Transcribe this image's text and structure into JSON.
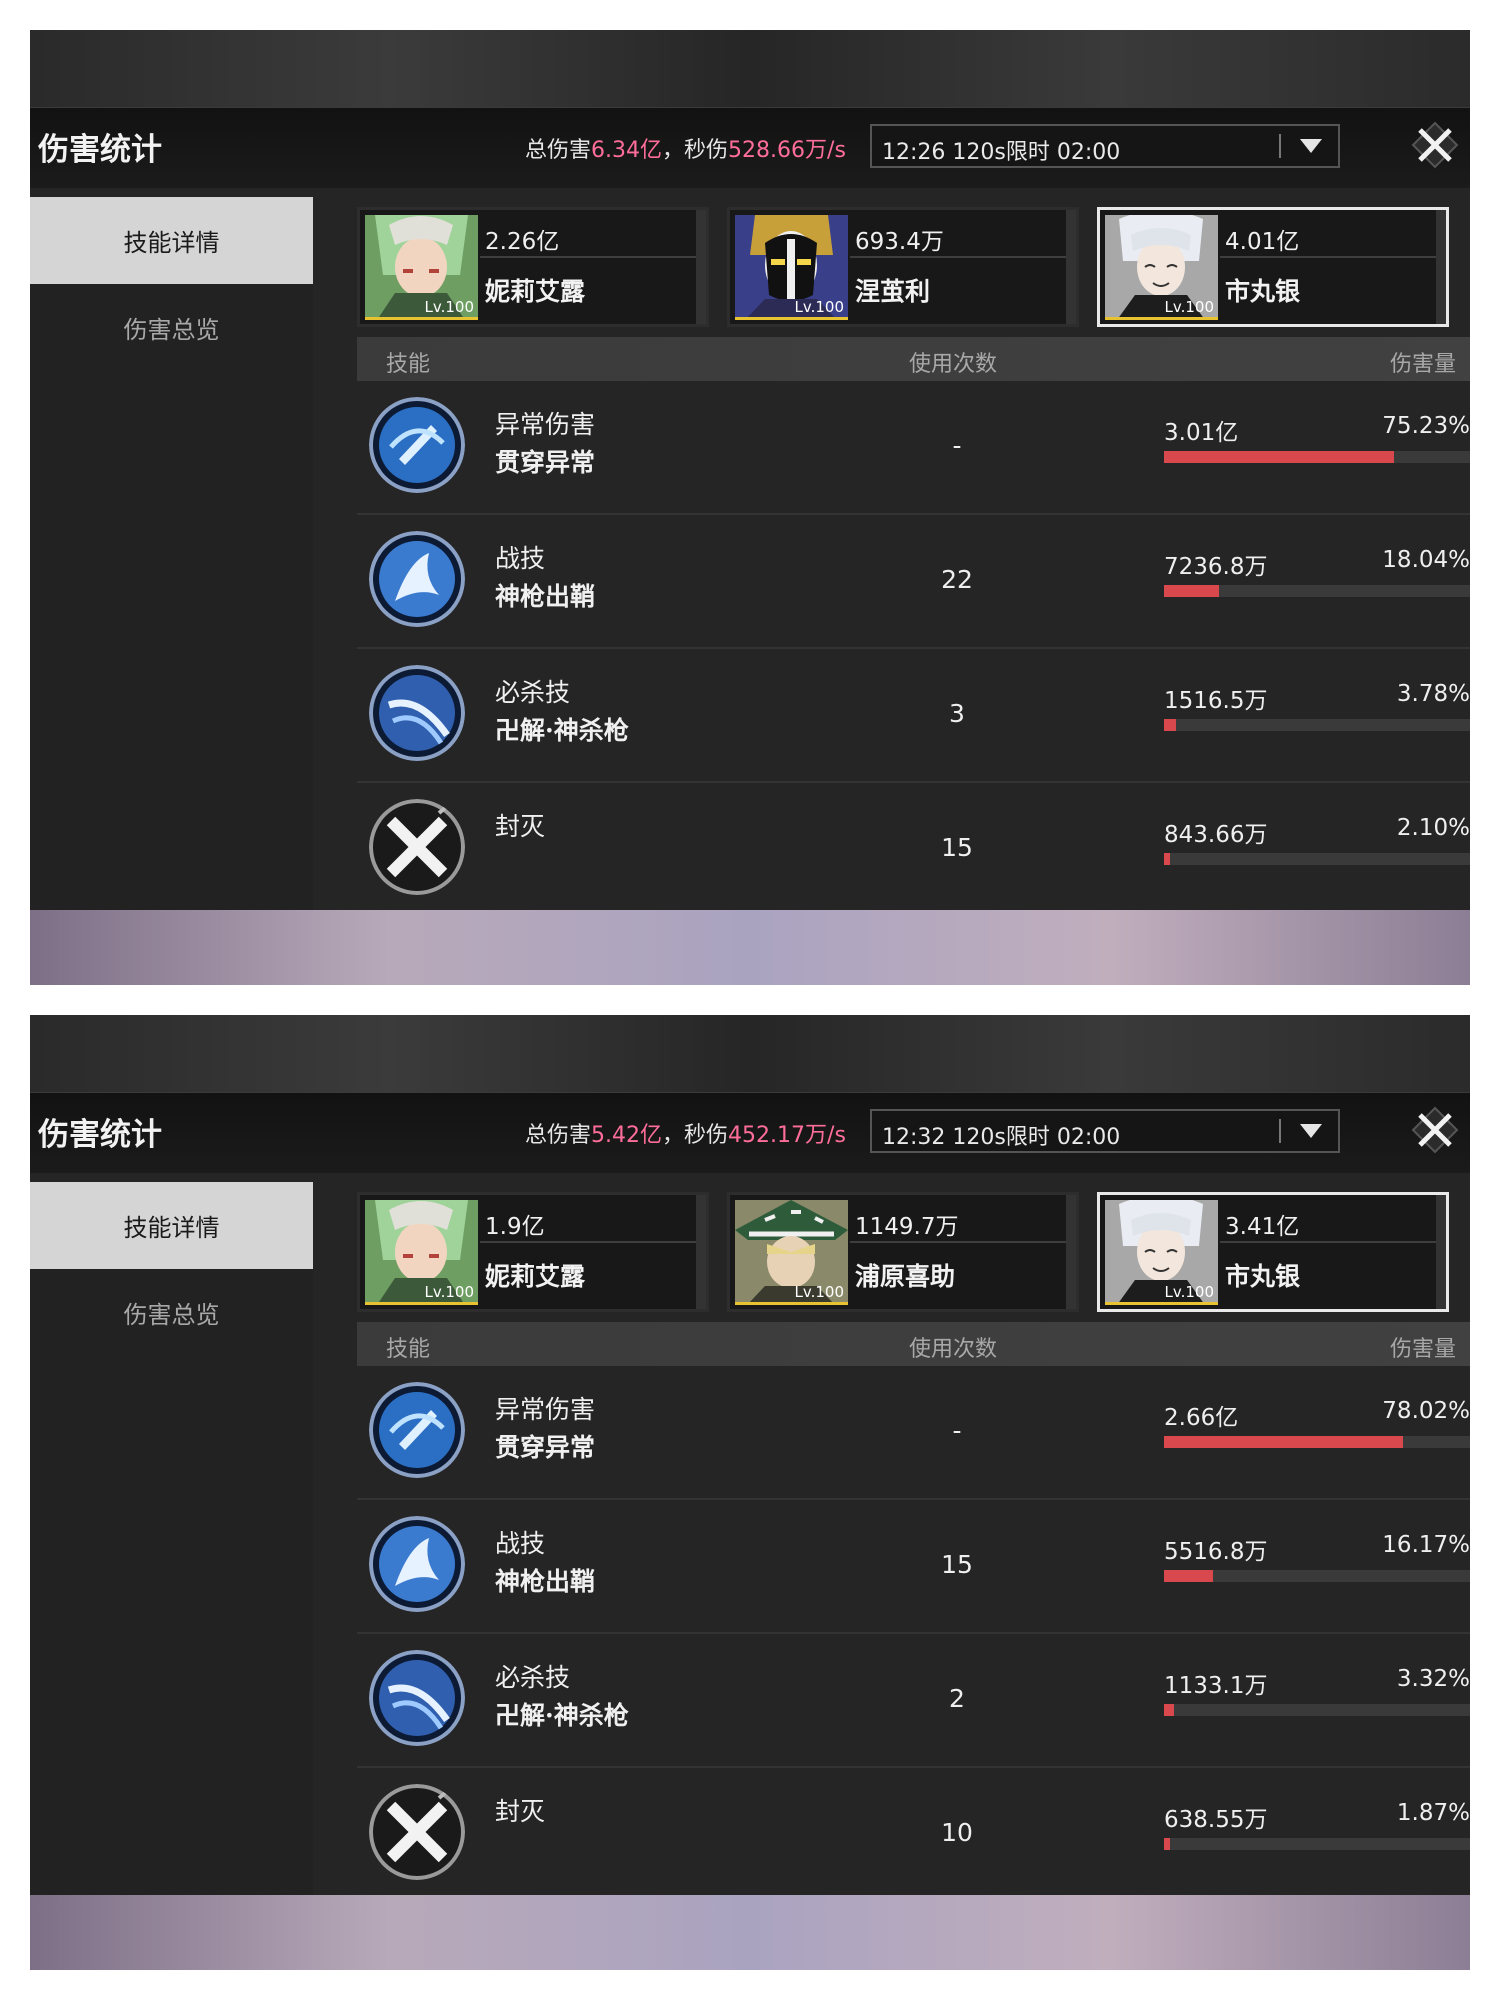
{
  "colors": {
    "accent_pink": "#ff6e9a",
    "bar_fill": "#d9484c",
    "level_bar": "#e7c332"
  },
  "panels": [
    {
      "title": "伤害统计",
      "summary": {
        "total_label": "总伤害",
        "total_value": "6.34亿",
        "sep": "，",
        "dps_label": "秒伤",
        "dps_value": "528.66万/s"
      },
      "dropdown": {
        "value": "12:26 120s限时 02:00",
        "arrow_icon": "triangle-down-icon"
      },
      "close_icon": "close-x-icon",
      "tabs": [
        {
          "label": "技能详情",
          "active": true
        },
        {
          "label": "伤害总览",
          "active": false
        }
      ],
      "characters": [
        {
          "damage": "2.26亿",
          "name": "妮莉艾露",
          "level": "Lv.100",
          "selected": false,
          "portrait_icon": "nelliel-portrait",
          "bg": "#6f9e63"
        },
        {
          "damage": "693.4万",
          "name": "涅茧利",
          "level": "Lv.100",
          "selected": false,
          "portrait_icon": "mayuri-portrait",
          "bg": "#3a3f8a"
        },
        {
          "damage": "4.01亿",
          "name": "市丸银",
          "level": "Lv.100",
          "selected": true,
          "portrait_icon": "gin-portrait",
          "bg": "#a8a8a8"
        }
      ],
      "table_headers": {
        "skill": "技能",
        "uses": "使用次数",
        "damage": "伤害量"
      },
      "skills": [
        {
          "type": "异常伤害",
          "name": "贯穿异常",
          "uses": "-",
          "damage": "3.01亿",
          "percent": "75.23%",
          "share": 0.7523,
          "icon": "pierce-anomaly-icon"
        },
        {
          "type": "战技",
          "name": "神枪出鞘",
          "uses": "22",
          "damage": "7236.8万",
          "percent": "18.04%",
          "share": 0.1804,
          "icon": "spear-draw-icon"
        },
        {
          "type": "必杀技",
          "name": "卍解·神杀枪",
          "uses": "3",
          "damage": "1516.5万",
          "percent": "3.78%",
          "share": 0.0378,
          "icon": "bankai-icon"
        },
        {
          "type": "封灭",
          "name": "",
          "uses": "15",
          "damage": "843.66万",
          "percent": "2.10%",
          "share": 0.021,
          "icon": "seal-icon"
        }
      ]
    },
    {
      "title": "伤害统计",
      "summary": {
        "total_label": "总伤害",
        "total_value": "5.42亿",
        "sep": "，",
        "dps_label": "秒伤",
        "dps_value": "452.17万/s"
      },
      "dropdown": {
        "value": "12:32 120s限时 02:00",
        "arrow_icon": "triangle-down-icon"
      },
      "close_icon": "close-x-icon",
      "tabs": [
        {
          "label": "技能详情",
          "active": true
        },
        {
          "label": "伤害总览",
          "active": false
        }
      ],
      "characters": [
        {
          "damage": "1.9亿",
          "name": "妮莉艾露",
          "level": "Lv.100",
          "selected": false,
          "portrait_icon": "nelliel-portrait",
          "bg": "#6f9e63"
        },
        {
          "damage": "1149.7万",
          "name": "浦原喜助",
          "level": "Lv.100",
          "selected": false,
          "portrait_icon": "urahara-portrait",
          "bg": "#8a8a6a"
        },
        {
          "damage": "3.41亿",
          "name": "市丸银",
          "level": "Lv.100",
          "selected": true,
          "portrait_icon": "gin-portrait",
          "bg": "#a8a8a8"
        }
      ],
      "table_headers": {
        "skill": "技能",
        "uses": "使用次数",
        "damage": "伤害量"
      },
      "skills": [
        {
          "type": "异常伤害",
          "name": "贯穿异常",
          "uses": "-",
          "damage": "2.66亿",
          "percent": "78.02%",
          "share": 0.7802,
          "icon": "pierce-anomaly-icon"
        },
        {
          "type": "战技",
          "name": "神枪出鞘",
          "uses": "15",
          "damage": "5516.8万",
          "percent": "16.17%",
          "share": 0.1617,
          "icon": "spear-draw-icon"
        },
        {
          "type": "必杀技",
          "name": "卍解·神杀枪",
          "uses": "2",
          "damage": "1133.1万",
          "percent": "3.32%",
          "share": 0.0332,
          "icon": "bankai-icon"
        },
        {
          "type": "封灭",
          "name": "",
          "uses": "10",
          "damage": "638.55万",
          "percent": "1.87%",
          "share": 0.0187,
          "icon": "seal-icon"
        }
      ]
    }
  ]
}
